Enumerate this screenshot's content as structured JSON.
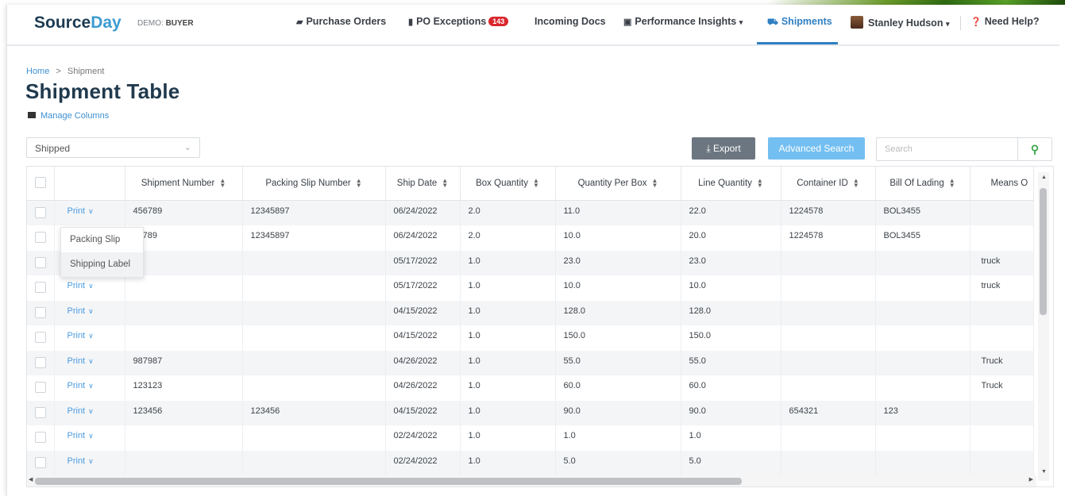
{
  "nav": {
    "logo_source": "Source",
    "logo_day": "Day",
    "demo_label": "DEMO:",
    "demo_role": "BUYER",
    "purchase_orders": "Purchase Orders",
    "po_exceptions": "PO Exceptions",
    "po_exceptions_count": "143",
    "incoming_docs": "Incoming Docs",
    "performance_insights": "Performance Insights",
    "shipments": "Shipments",
    "user_name": "Stanley Hudson",
    "help": "Need Help?"
  },
  "breadcrumb": {
    "home": "Home",
    "separator": ">",
    "current": "Shipment"
  },
  "page_title": "Shipment Table",
  "manage_columns": "Manage Columns",
  "filters": {
    "status_value": "Shipped",
    "export_label": "Export",
    "advanced_search_label": "Advanced Search",
    "search_placeholder": "Search"
  },
  "table": {
    "columns": [
      "Shipment Number",
      "Packing Slip Number",
      "Ship Date",
      "Box Quantity",
      "Quantity Per Box",
      "Line Quantity",
      "Container ID",
      "Bill Of Lading",
      "Means O"
    ],
    "print_label": "Print",
    "rows": [
      [
        "456789",
        "12345897",
        "06/24/2022",
        "2.0",
        "11.0",
        "22.0",
        "1224578",
        "BOL3455",
        ""
      ],
      [
        "6789",
        "12345897",
        "06/24/2022",
        "2.0",
        "10.0",
        "20.0",
        "1224578",
        "BOL3455",
        ""
      ],
      [
        "",
        "",
        "05/17/2022",
        "1.0",
        "23.0",
        "23.0",
        "",
        "",
        "truck"
      ],
      [
        "",
        "",
        "05/17/2022",
        "1.0",
        "10.0",
        "10.0",
        "",
        "",
        "truck"
      ],
      [
        "",
        "",
        "04/15/2022",
        "1.0",
        "128.0",
        "128.0",
        "",
        "",
        ""
      ],
      [
        "",
        "",
        "04/15/2022",
        "1.0",
        "150.0",
        "150.0",
        "",
        "",
        ""
      ],
      [
        "987987",
        "",
        "04/26/2022",
        "1.0",
        "55.0",
        "55.0",
        "",
        "",
        "Truck"
      ],
      [
        "123123",
        "",
        "04/26/2022",
        "1.0",
        "60.0",
        "60.0",
        "",
        "",
        "Truck"
      ],
      [
        "123456",
        "123456",
        "04/15/2022",
        "1.0",
        "90.0",
        "90.0",
        "654321",
        "123",
        ""
      ],
      [
        "",
        "",
        "02/24/2022",
        "1.0",
        "1.0",
        "1.0",
        "",
        "",
        ""
      ],
      [
        "",
        "",
        "02/24/2022",
        "1.0",
        "5.0",
        "5.0",
        "",
        "",
        ""
      ]
    ]
  },
  "print_menu": {
    "options": [
      "Packing Slip",
      "Shipping Label"
    ],
    "hovered": "Shipping Label"
  },
  "colors": {
    "accent": "#2f7fc1",
    "link": "#4b9be0",
    "badge": "#d9262c",
    "search_icon": "#3aa64a"
  }
}
